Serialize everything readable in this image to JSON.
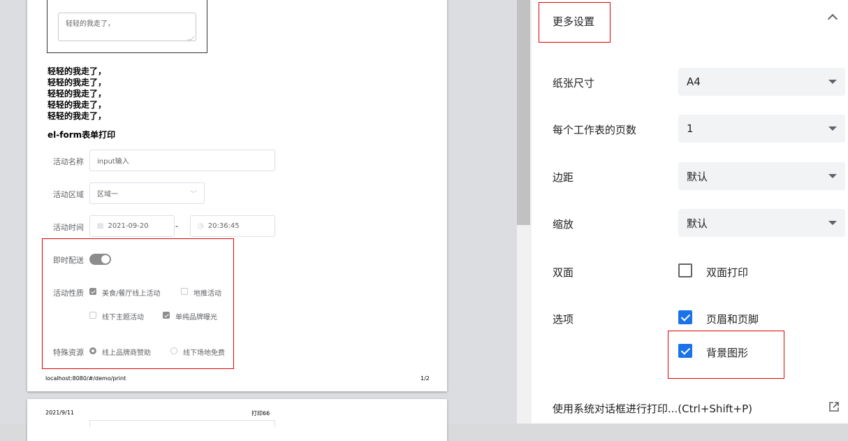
{
  "preview": {
    "page1": {
      "textarea_value": "轻轻的我走了，",
      "poem_lines": [
        "轻轻的我走了，",
        "轻轻的我走了，",
        "轻轻的我走了，",
        "轻轻的我走了，",
        "轻轻的我走了，"
      ],
      "form_title": "el-form表单打印",
      "fields": {
        "activity_name_label": "活动名称",
        "activity_name_value": "input输入",
        "activity_region_label": "活动区域",
        "activity_region_value": "区域一",
        "activity_time_label": "活动时间",
        "date_value": "2021-09-20",
        "time_separator": "-",
        "time_value": "20:36:45",
        "instant_delivery_label": "即时配送",
        "activity_type_label": "活动性质",
        "type_options": [
          "美食/餐厅线上活动",
          "地推活动",
          "线下主题活动",
          "单纯品牌曝光"
        ],
        "special_resource_label": "特殊资源",
        "resource_options": [
          "线上品牌商赞助",
          "线下场地免费"
        ]
      },
      "footer_url": "localhost:8080/#/demo/print",
      "footer_page": "1/2"
    },
    "page2": {
      "header_date": "2021/9/11",
      "header_title": "打印66"
    }
  },
  "settings": {
    "section_title": "更多设置",
    "paper_size_label": "纸张尺寸",
    "paper_size_value": "A4",
    "pages_per_sheet_label": "每个工作表的页数",
    "pages_per_sheet_value": "1",
    "margins_label": "边距",
    "margins_value": "默认",
    "scale_label": "缩放",
    "scale_value": "默认",
    "duplex_label": "双面",
    "duplex_option": "双面打印",
    "options_label": "选项",
    "headers_footers_option": "页眉和页脚",
    "background_graphics_option": "背景图形",
    "system_dialog_link": "使用系统对话框进行打印...(Ctrl+Shift+P)"
  }
}
